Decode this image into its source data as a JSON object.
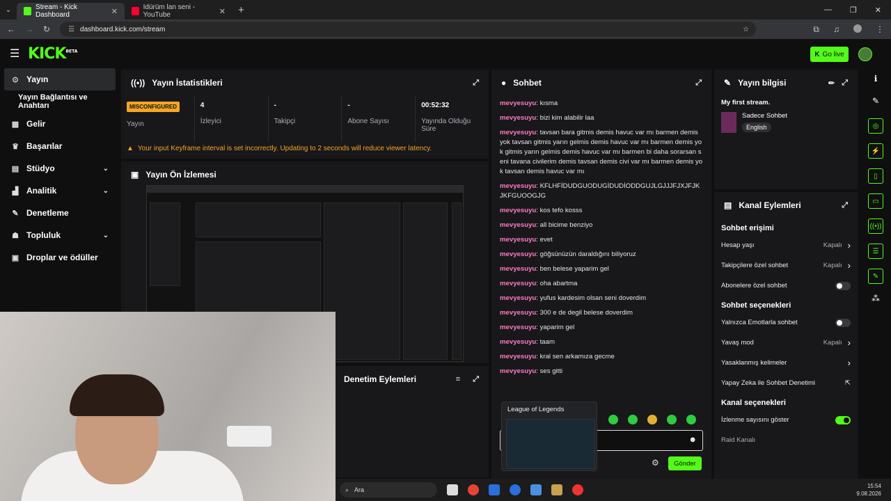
{
  "browser": {
    "tabs": [
      {
        "title": "Stream - Kick Dashboard",
        "active": true
      },
      {
        "title": "Idürüm lan seni - YouTube",
        "active": false
      }
    ],
    "url": "dashboard.kick.com/stream"
  },
  "kick": {
    "logo": "KICK",
    "logo_sup": "BETA",
    "go_live": "Go live"
  },
  "sidebar": {
    "items": [
      {
        "label": "Yayın",
        "active": true
      },
      {
        "label": "Yayın Bağlantısı ve Anahtarı"
      },
      {
        "label": "Gelir"
      },
      {
        "label": "Başarılar"
      },
      {
        "label": "Stüdyo"
      },
      {
        "label": "Analitik"
      },
      {
        "label": "Denetleme"
      },
      {
        "label": "Topluluk"
      },
      {
        "label": "Droplar ve ödüller"
      }
    ]
  },
  "stats": {
    "title": "Yayın İstatistikleri",
    "badge": "MISCONFIGURED",
    "cells": [
      {
        "value": "",
        "label": "Yayın"
      },
      {
        "value": "4",
        "label": "İzleyici"
      },
      {
        "value": "-",
        "label": "Takipçi"
      },
      {
        "value": "-",
        "label": "Abone Sayısı"
      },
      {
        "value": "00:52:32",
        "label": "Yayında Olduğu Süre"
      }
    ],
    "warning": "Your input Keyframe interval is set incorrectly. Updating to 2 seconds will reduce viewer latency."
  },
  "preview": {
    "title": "Yayın Ön İzlemesi"
  },
  "moderation": {
    "title": "Denetim Eylemleri"
  },
  "chat": {
    "title": "Sohbet",
    "messages": [
      {
        "user": "mevyesuyu",
        "text": "kısma"
      },
      {
        "user": "mevyesuyu",
        "text": "bizi kim alabilir laa"
      },
      {
        "user": "mevyesuyu",
        "text": "tavsan bara gitmis demis havuc var mı barmen demis yok tavsan gitmis yarın gelmis demis havuc var mı barmen demis yok gitmis yarın gelmis demis havuc var mı barmen bi daha sorarsan seni tavana civilerim demis tavsan demis civi var mı barmen demis yok tavsan demis havuc var mı"
      },
      {
        "user": "mevyesuyu",
        "text": "KFLHFİDUDGUODUGİDUDİODDGUJLGJJJFJXJFJKJKFGUOOGJG"
      },
      {
        "user": "mevyesuyu",
        "text": "kos tefo kosss"
      },
      {
        "user": "mevyesuyu",
        "text": "all bicime benziyo"
      },
      {
        "user": "mevyesuyu",
        "text": "evet"
      },
      {
        "user": "mevyesuyu",
        "text": "göğsünüzün daraldığını biliyoruz"
      },
      {
        "user": "mevyesuyu",
        "text": "ben belese yaparim gel"
      },
      {
        "user": "mevyesuyu",
        "text": "oha abartma"
      },
      {
        "user": "mevyesuyu",
        "text": "yufus kardesim olsan seni doverdim"
      },
      {
        "user": "mevyesuyu",
        "text": "300 e de degil belese doverdim"
      },
      {
        "user": "mevyesuyu",
        "text": "yaparim gel"
      },
      {
        "user": "mevyesuyu",
        "text": "taam"
      },
      {
        "user": "mevyesuyu",
        "text": "kral sen arkamıza gecme"
      },
      {
        "user": "mevyesuyu",
        "text": "ses gitti"
      }
    ],
    "send": "Gönder",
    "popup_title": "League of Legends"
  },
  "info": {
    "title": "Yayın bilgisi",
    "stream_title": "My first stream.",
    "category": "Sadece Sohbet",
    "language": "English"
  },
  "actions": {
    "title": "Kanal Eylemleri",
    "sections": [
      {
        "title": "Sohbet erişimi",
        "rows": [
          {
            "label": "Hesap yaşı",
            "value": "Kapalı",
            "control": "chevron"
          },
          {
            "label": "Takipçilere özel sohbet",
            "value": "Kapalı",
            "control": "chevron"
          },
          {
            "label": "Abonelere özel sohbet",
            "value": "",
            "control": "toggle-off"
          }
        ]
      },
      {
        "title": "Sohbet seçenekleri",
        "rows": [
          {
            "label": "Yalnızca Emotlarla sohbet",
            "value": "",
            "control": "toggle-off"
          },
          {
            "label": "Yavaş mod",
            "value": "Kapalı",
            "control": "chevron"
          },
          {
            "label": "Yasaklanmış kelimeler",
            "value": "",
            "control": "chevron"
          },
          {
            "label": "Yapay Zeka ile Sohbet Denetimi",
            "value": "",
            "control": "external"
          }
        ]
      },
      {
        "title": "Kanal seçenekleri",
        "rows": [
          {
            "label": "İzlenme sayısını göster",
            "value": "",
            "control": "toggle-on"
          },
          {
            "label": "Raid Kanalı",
            "value": "",
            "control": "none"
          }
        ]
      }
    ]
  },
  "taskbar": {
    "search": "Ara",
    "time": "15:54",
    "date": "9.08.2026"
  },
  "colors": {
    "accent": "#53fc18",
    "username": "#ff7ac3",
    "warning": "#f5a623"
  }
}
